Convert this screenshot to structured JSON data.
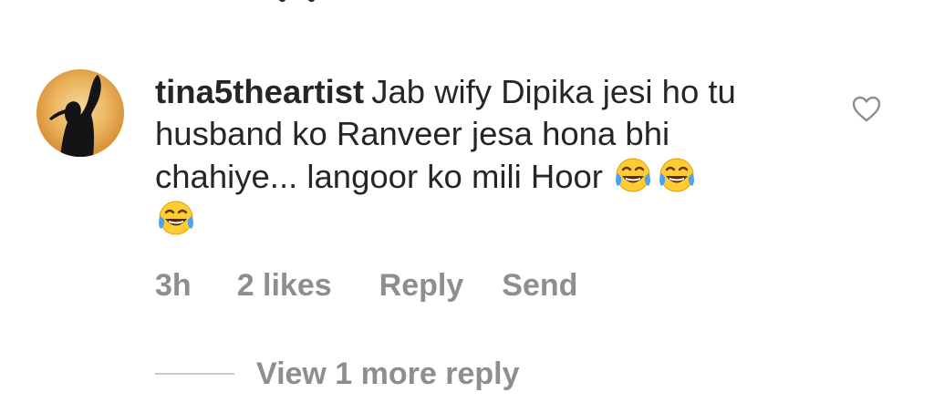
{
  "comment": {
    "username": "tina5theartist",
    "text": "Jab wify Dipika jesi ho tu husband ko Ranveer jesa hona bhi chahiye... langoor ko mili Hoor",
    "emojis": [
      "face-with-tears-of-joy",
      "face-with-tears-of-joy",
      "face-with-tears-of-joy"
    ],
    "avatar_icon": "silhouette-avatar",
    "like_icon": "heart-outline-icon"
  },
  "actions": {
    "time": "3h",
    "likes": "2 likes",
    "reply": "Reply",
    "send": "Send"
  },
  "replies": {
    "view_more_label": "View 1 more reply"
  },
  "colors": {
    "text": "#262626",
    "secondary": "#8e8e8e",
    "divider": "#c7c7c7",
    "avatar_bg": "#e8a13c"
  }
}
